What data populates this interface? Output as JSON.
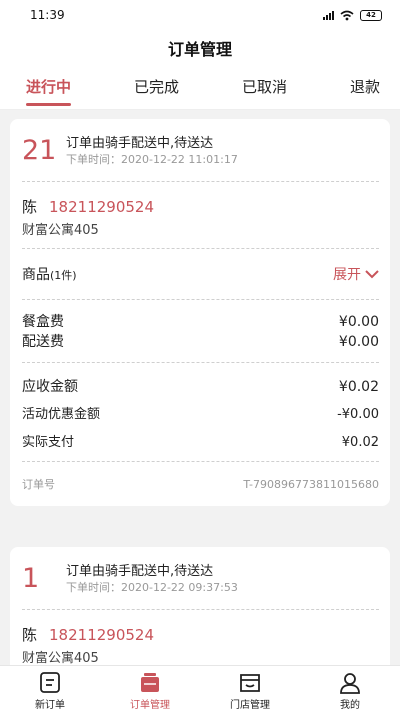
{
  "status_bar": {
    "time": "11:39",
    "battery": "42"
  },
  "header": {
    "title": "订单管理"
  },
  "tabs": [
    {
      "label": "进行中",
      "active": true
    },
    {
      "label": "已完成",
      "active": false
    },
    {
      "label": "已取消",
      "active": false
    },
    {
      "label": "退款",
      "active": false
    }
  ],
  "orders": [
    {
      "number": "21",
      "status": "订单由骑手配送中,待送达",
      "time": "下单时间：2020-12-22 11:01:17",
      "customer_name": "陈",
      "customer_phone": "18211290524",
      "address": "财富公寓405",
      "goods_label": "商品",
      "goods_count": "(1件)",
      "expand_label": "展开",
      "box_fee_label": "餐盒费",
      "box_fee": "¥0.00",
      "delivery_fee_label": "配送费",
      "delivery_fee": "¥0.00",
      "receivable_label": "应收金额",
      "receivable": "¥0.02",
      "discount_label": "活动优惠金额",
      "discount": "-¥0.00",
      "paid_label": "实际支付",
      "paid": "¥0.02",
      "order_no_label": "订单号",
      "order_no": "T-790896773811015680"
    },
    {
      "number": "1",
      "status": "订单由骑手配送中,待送达",
      "time": "下单时间：2020-12-22 09:37:53",
      "customer_name": "陈",
      "customer_phone": "18211290524",
      "address": "财富公寓405"
    }
  ],
  "bottom_nav": [
    {
      "label": "新订单",
      "icon": "new-order-icon",
      "active": false
    },
    {
      "label": "订单管理",
      "icon": "order-manage-icon",
      "active": true
    },
    {
      "label": "门店管理",
      "icon": "store-icon",
      "active": false
    },
    {
      "label": "我的",
      "icon": "user-icon",
      "active": false
    }
  ],
  "colors": {
    "accent": "#c8545a",
    "background": "#f2f2f2"
  }
}
